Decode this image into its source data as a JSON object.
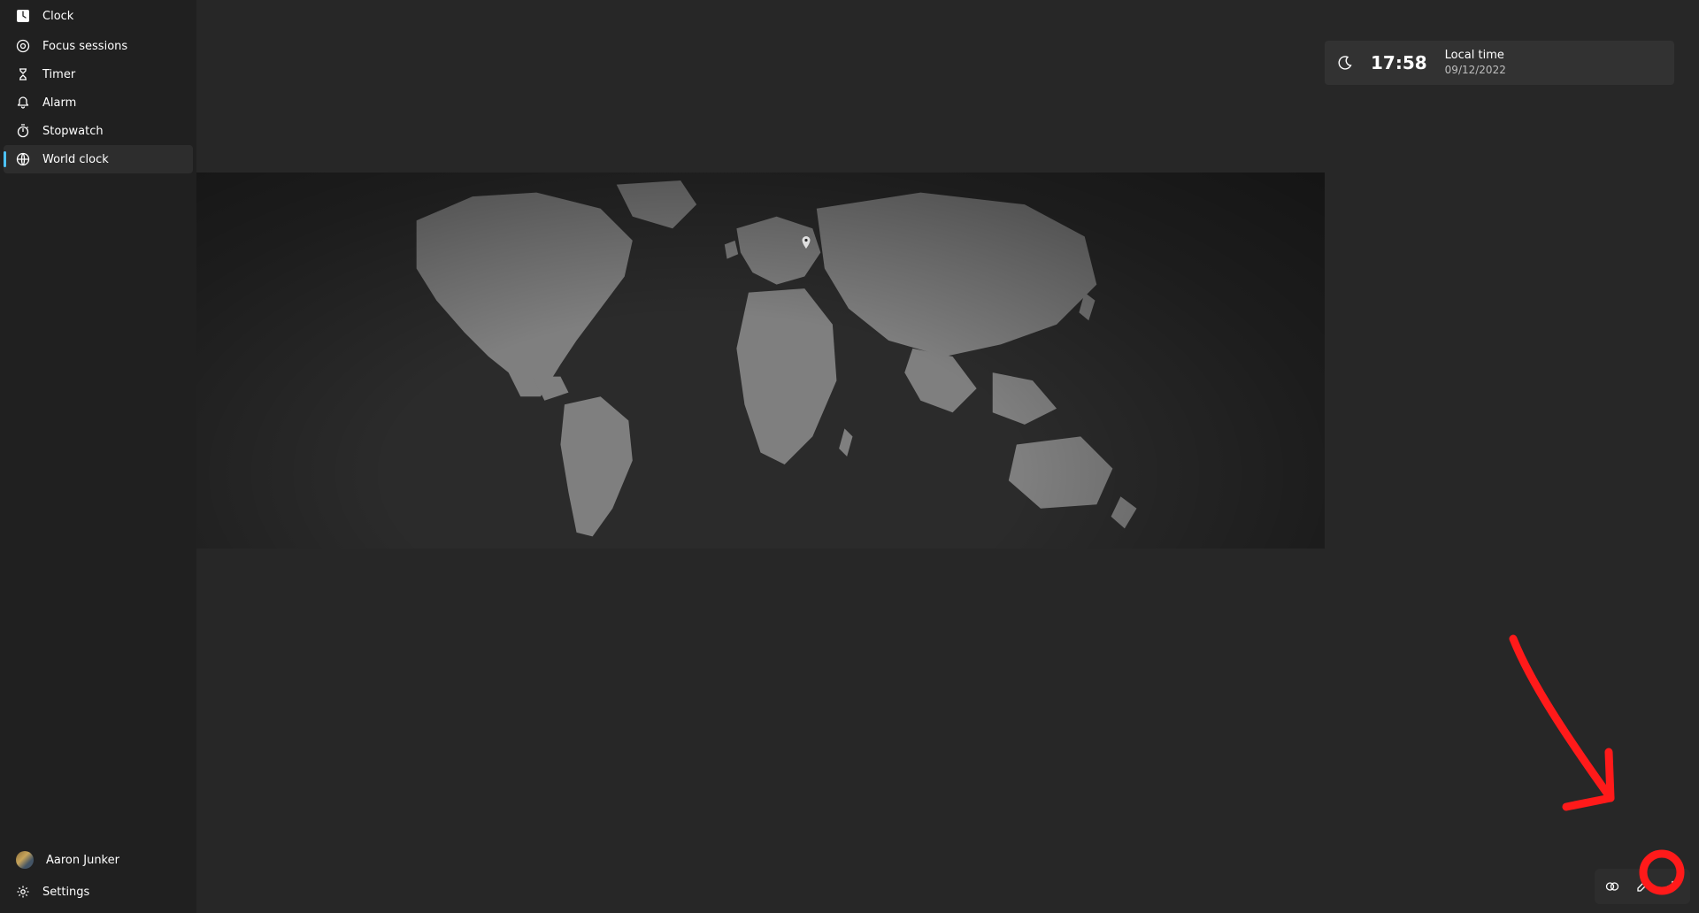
{
  "app": {
    "title": "Clock"
  },
  "sidebar": {
    "items": [
      {
        "label": "Focus sessions",
        "icon": "focus"
      },
      {
        "label": "Timer",
        "icon": "hourglass"
      },
      {
        "label": "Alarm",
        "icon": "bell"
      },
      {
        "label": "Stopwatch",
        "icon": "stopwatch"
      },
      {
        "label": "World clock",
        "icon": "globe",
        "selected": true
      }
    ],
    "user": {
      "name": "Aaron Junker"
    },
    "settings_label": "Settings"
  },
  "local_time": {
    "time": "17:58",
    "label": "Local time",
    "date": "09/12/2022"
  },
  "actions": {
    "compare": "compare",
    "edit": "edit",
    "add": "add"
  }
}
